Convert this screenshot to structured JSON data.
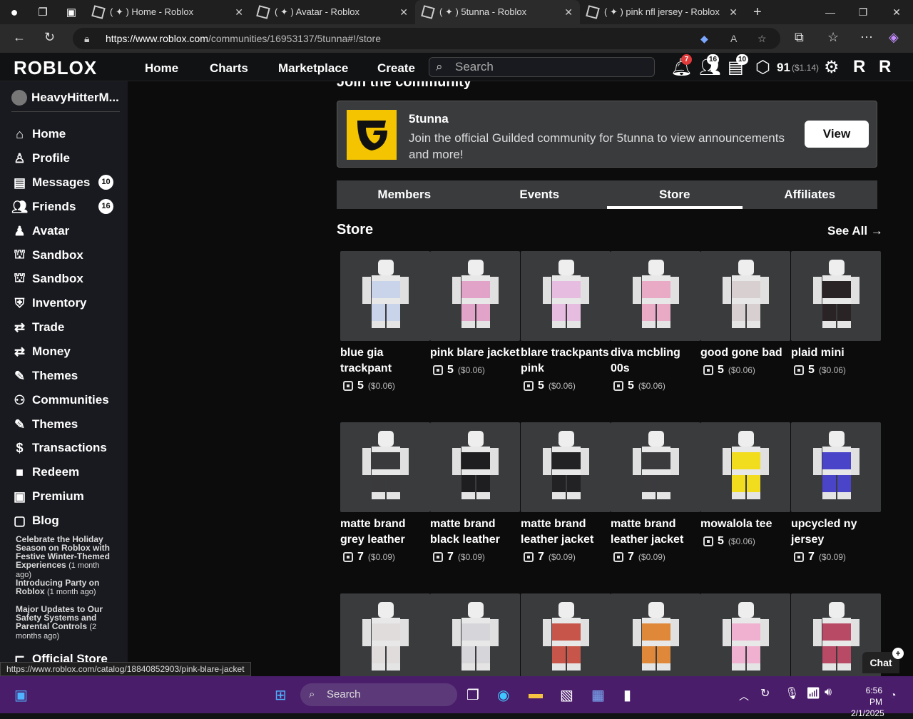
{
  "browser": {
    "tabs": [
      {
        "title": "( ✦ ) Home - Roblox"
      },
      {
        "title": "( ✦ ) Avatar - Roblox"
      },
      {
        "title": "( ✦ ) 5tunna - Roblox"
      },
      {
        "title": "( ✦ ) pink nfl jersey - Roblox"
      }
    ],
    "url_host": "https://www.roblox.com",
    "url_path": "/communities/16953137/5tunna#!/store",
    "status_url": "https://www.roblox.com/catalog/18840852903/pink-blare-jacket"
  },
  "header": {
    "logo": "ROBLOX",
    "nav": [
      "Home",
      "Charts",
      "Marketplace",
      "Create"
    ],
    "search_placeholder": "Search",
    "notifications_count": "7",
    "friends_count": "16",
    "messages_count": "10",
    "robux": "91",
    "robux_usd": "($1.14)"
  },
  "sidebar": {
    "username": "HeavyHitterM...",
    "items": [
      {
        "label": "Home",
        "icon": "home-icon"
      },
      {
        "label": "Profile",
        "icon": "profile-icon"
      },
      {
        "label": "Messages",
        "icon": "messages-icon",
        "badge": "10"
      },
      {
        "label": "Friends",
        "icon": "friends-icon",
        "badge": "16"
      },
      {
        "label": "Avatar",
        "icon": "avatar-icon"
      },
      {
        "label": "Sandbox",
        "icon": "sandbox-icon"
      },
      {
        "label": "Sandbox",
        "icon": "sandbox-icon"
      },
      {
        "label": "Inventory",
        "icon": "inventory-icon"
      },
      {
        "label": "Trade",
        "icon": "trade-icon"
      },
      {
        "label": "Money",
        "icon": "money-icon"
      },
      {
        "label": "Themes",
        "icon": "themes-icon"
      },
      {
        "label": "Communities",
        "icon": "communities-icon"
      },
      {
        "label": "Themes",
        "icon": "themes-icon"
      },
      {
        "label": "Transactions",
        "icon": "transactions-icon"
      },
      {
        "label": "Redeem",
        "icon": "redeem-icon"
      },
      {
        "label": "Premium",
        "icon": "premium-icon"
      },
      {
        "label": "Blog",
        "icon": "blog-icon"
      }
    ],
    "blog_posts": [
      {
        "title": "Celebrate the Holiday Season on Roblox with Festive Winter-Themed Experiences",
        "age": "(1 month ago)"
      },
      {
        "title": "Introducing Party on Roblox",
        "age": "(1 month ago)"
      },
      {
        "title": "Major Updates to Our Safety Systems and Parental Controls",
        "age": "(2 months ago)"
      }
    ],
    "official_store": "Official Store"
  },
  "community": {
    "join_title": "Join the community",
    "guilded": {
      "name": "5tunna",
      "description": "Join the official Guilded community for 5tunna to view announcements and more!",
      "button": "View"
    },
    "tabs": [
      "Members",
      "Events",
      "Store",
      "Affiliates"
    ],
    "active_tab": "Store"
  },
  "store": {
    "title": "Store",
    "see_all": "See All →",
    "items": [
      {
        "name": "blue gia trackpant",
        "price": "5",
        "usd": "($0.06)",
        "color": "#c9d3ea"
      },
      {
        "name": "pink blare jacket",
        "price": "5",
        "usd": "($0.06)",
        "color": "#e2a3c8"
      },
      {
        "name": "blare trackpants pink",
        "price": "5",
        "usd": "($0.06)",
        "color": "#e6bde0"
      },
      {
        "name": "diva mcbling 00s",
        "price": "5",
        "usd": "($0.06)",
        "color": "#e9aac6"
      },
      {
        "name": "good gone bad",
        "price": "5",
        "usd": "($0.06)",
        "color": "#d8d0d0"
      },
      {
        "name": "plaid mini",
        "price": "5",
        "usd": "($0.06)",
        "color": "#2a2326"
      },
      {
        "name": "matte brand grey leather",
        "price": "7",
        "usd": "($0.09)",
        "color": "#3a3a3c"
      },
      {
        "name": "matte brand black leather",
        "price": "7",
        "usd": "($0.09)",
        "color": "#1e1e20"
      },
      {
        "name": "matte brand leather jacket",
        "price": "7",
        "usd": "($0.09)",
        "color": "#222224"
      },
      {
        "name": "matte brand leather jacket",
        "price": "7",
        "usd": "($0.09)",
        "color": "#3b3b3e"
      },
      {
        "name": "mowalola tee",
        "price": "5",
        "usd": "($0.06)",
        "color": "#f2dc1e"
      },
      {
        "name": "upcycled ny jersey",
        "price": "7",
        "usd": "($0.09)",
        "color": "#4a44c9"
      },
      {
        "name": "",
        "price": "",
        "usd": "",
        "color": "#e0dcdc"
      },
      {
        "name": "",
        "price": "",
        "usd": "",
        "color": "#d6d6da"
      },
      {
        "name": "",
        "price": "",
        "usd": "",
        "color": "#c8554a"
      },
      {
        "name": "",
        "price": "",
        "usd": "",
        "color": "#e0883a"
      },
      {
        "name": "",
        "price": "",
        "usd": "",
        "color": "#f0b0d0"
      },
      {
        "name": "",
        "price": "",
        "usd": "",
        "color": "#b84a66"
      }
    ]
  },
  "chat": {
    "label": "Chat"
  },
  "taskbar": {
    "search_placeholder": "Search",
    "time": "6:56 PM",
    "date": "2/1/2025"
  }
}
